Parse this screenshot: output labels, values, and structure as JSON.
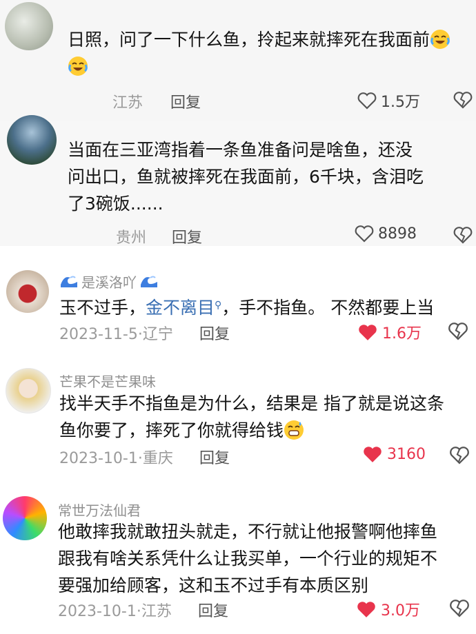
{
  "comments": [
    {
      "text": "日照，问了一下什么鱼，拎起来就摔死在我面前",
      "emoji_count": 2,
      "emoji_icon": "laugh-cry-emoji",
      "location": "江苏",
      "reply": "回复",
      "likes": "1.5万"
    },
    {
      "text_line1": "当面在三亚湾指着一条鱼准备问是啥鱼，还没",
      "text_line2": "问出口，鱼就被摔死在我面前，6千块，含泪吃",
      "text_line3": "了3碗饭......",
      "location": "贵州",
      "reply": "回复",
      "likes": "8898"
    },
    {
      "username": "是溪洛吖",
      "username_icon": "wave-emoji",
      "text_a": "玉不过手，",
      "text_link": "金不离目",
      "text_b": "，手不指鱼。 不然都要上当",
      "date_location": "2023-11-5·辽宁",
      "reply": "回复",
      "likes": "1.6万"
    },
    {
      "username": "芒果不是芒果味",
      "text_line1": "找半天手不指鱼是为什么，结果是 指了就是说这条",
      "text_line2": "鱼你要了，摔死了你就得给钱",
      "emoji_icon": "sweat-grin-emoji",
      "date_location": "2023-10-1·重庆",
      "reply": "回复",
      "likes": "3160"
    },
    {
      "username": "常世万法仙君",
      "text_line1": "他敢摔我就敢扭头就走，不行就让他报警啊他摔鱼",
      "text_line2": "跟我有啥关系凭什么让我买单，一个行业的规矩不",
      "text_line3": "要强加给顾客，这和玉不过手有本质区别",
      "date_location": "2023-10-1·江苏",
      "reply": "回复",
      "likes": "3.0万"
    }
  ],
  "colors": {
    "like_red": "#e8344c",
    "link_blue": "#3a6fb3",
    "meta_gray": "#9a9a9a"
  }
}
